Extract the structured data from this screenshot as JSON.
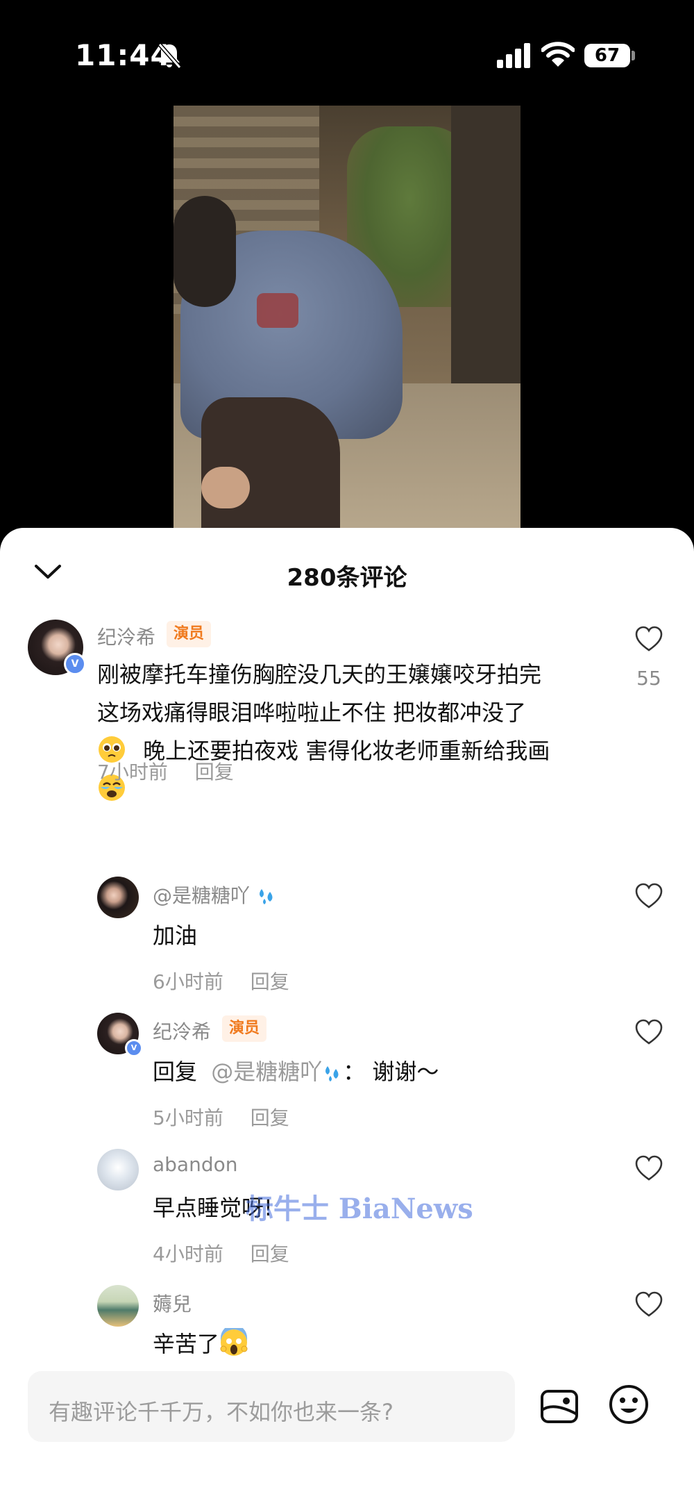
{
  "status_bar": {
    "time": "11:44",
    "battery": "67"
  },
  "sheet": {
    "title": "280条评论"
  },
  "comments": [
    {
      "username": "纪泠希",
      "tag": "演员",
      "text_line1": "刚被摩托车撞伤胸腔没几天的王嬢嬢咬牙拍完",
      "text_line2": "这场戏痛得眼泪哗啦啦止不住 把妆都冲没了",
      "text_line3": "晚上还要拍夜戏 害得化妆老师重新给我画",
      "time": "7小时前",
      "reply_label": "回复",
      "likes": "55"
    }
  ],
  "replies": [
    {
      "username": "@是糖糖吖",
      "text": "加油",
      "time": "6小时前",
      "reply_label": "回复"
    },
    {
      "username": "纪泠希",
      "tag": "演员",
      "text_prefix": "回复",
      "mention": "@是糖糖吖",
      "text_suffix": "：  谢谢～",
      "time": "5小时前",
      "reply_label": "回复"
    },
    {
      "username": "abandon",
      "text": "早点睡觉呀!",
      "time": "4小时前",
      "reply_label": "回复"
    },
    {
      "username": "薅兒",
      "text": "辛苦了"
    }
  ],
  "watermark": "标牛士 BiaNews",
  "input": {
    "placeholder": "有趣评论千千万，不如你也来一条?"
  },
  "icons": [
    "bell-off-icon",
    "signal-icon",
    "wifi-icon",
    "chevron-down-icon",
    "heart-icon",
    "image-icon",
    "emoji-icon",
    "sweat-drops-icon"
  ],
  "colors": {
    "tag_text": "#f07a1e",
    "tag_bg": "#fff1e6",
    "verified": "#5b8def"
  }
}
